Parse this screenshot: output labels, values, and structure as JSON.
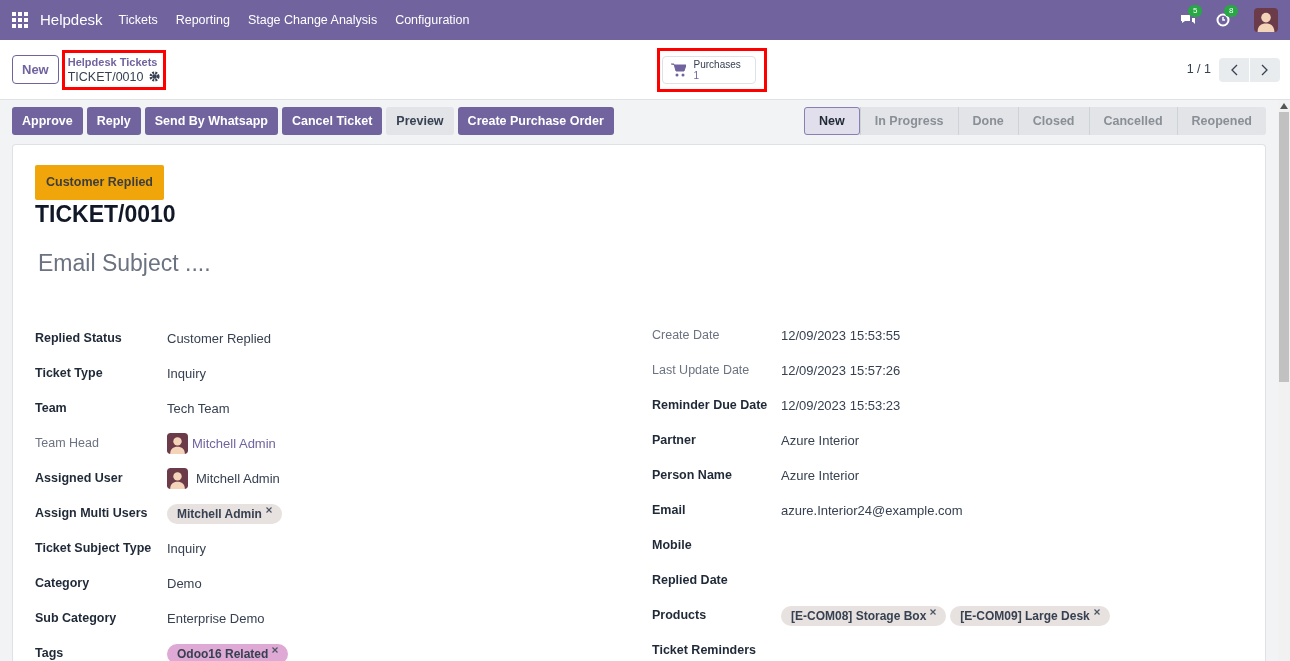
{
  "navbar": {
    "app": "Helpdesk",
    "menus": [
      "Tickets",
      "Reporting",
      "Stage Change Analysis",
      "Configuration"
    ],
    "messages_badge": "5",
    "activities_badge": "8"
  },
  "control_panel": {
    "new_button": "New",
    "breadcrumb": "Helpdesk Tickets",
    "record": "TICKET/0010",
    "smart_button": {
      "label": "Purchases",
      "count": "1"
    },
    "pager": "1 / 1"
  },
  "actions": [
    {
      "label": "Approve",
      "kind": "primary"
    },
    {
      "label": "Reply",
      "kind": "primary"
    },
    {
      "label": "Send By Whatsapp",
      "kind": "primary"
    },
    {
      "label": "Cancel Ticket",
      "kind": "primary"
    },
    {
      "label": "Preview",
      "kind": "secondary"
    },
    {
      "label": "Create Purchase Order",
      "kind": "primary"
    }
  ],
  "stages": [
    {
      "label": "New",
      "selected": true
    },
    {
      "label": "In Progress",
      "selected": false
    },
    {
      "label": "Done",
      "selected": false
    },
    {
      "label": "Closed",
      "selected": false
    },
    {
      "label": "Cancelled",
      "selected": false
    },
    {
      "label": "Reopened",
      "selected": false
    }
  ],
  "sheet": {
    "ribbon": "Customer Replied",
    "title": "TICKET/0010",
    "subject_placeholder": "Email Subject ....",
    "left_fields": [
      {
        "label": "Replied Status",
        "kind": "text",
        "value": "Customer Replied",
        "readonly": false
      },
      {
        "label": "Ticket Type",
        "kind": "text",
        "value": "Inquiry",
        "readonly": false
      },
      {
        "label": "Team",
        "kind": "text",
        "value": "Tech Team",
        "readonly": false
      },
      {
        "label": "Team Head",
        "kind": "user_link",
        "value": "Mitchell Admin",
        "readonly": true
      },
      {
        "label": "Assigned User",
        "kind": "user",
        "value": "Mitchell Admin",
        "readonly": false
      },
      {
        "label": "Assign Multi Users",
        "kind": "tags",
        "tags": [
          {
            "label": "Mitchell Admin",
            "color": "#e7e1df"
          }
        ],
        "readonly": false
      },
      {
        "label": "Ticket Subject Type",
        "kind": "text",
        "value": "Inquiry",
        "readonly": false
      },
      {
        "label": "Category",
        "kind": "text",
        "value": "Demo",
        "readonly": false
      },
      {
        "label": "Sub Category",
        "kind": "text",
        "value": "Enterprise Demo",
        "readonly": false
      },
      {
        "label": "Tags",
        "kind": "tags",
        "tags": [
          {
            "label": "Odoo16 Related",
            "color": "#dfa9d5"
          }
        ],
        "readonly": false
      }
    ],
    "right_fields": [
      {
        "label": "Create Date",
        "kind": "text",
        "value": "12/09/2023 15:53:55",
        "readonly": true
      },
      {
        "label": "Last Update Date",
        "kind": "text",
        "value": "12/09/2023 15:57:26",
        "readonly": true
      },
      {
        "label": "Reminder Due Date",
        "kind": "text",
        "value": "12/09/2023 15:53:23",
        "readonly": false
      },
      {
        "label": "Partner",
        "kind": "text",
        "value": "Azure Interior",
        "readonly": false
      },
      {
        "label": "Person Name",
        "kind": "text",
        "value": "Azure Interior",
        "readonly": false
      },
      {
        "label": "Email",
        "kind": "text",
        "value": "azure.Interior24@example.com",
        "readonly": false
      },
      {
        "label": "Mobile",
        "kind": "empty",
        "readonly": false
      },
      {
        "label": "Replied Date",
        "kind": "empty",
        "readonly": false
      },
      {
        "label": "Products",
        "kind": "tags",
        "tags": [
          {
            "label": "[E-COM08] Storage Box",
            "color": "#e7e1df"
          },
          {
            "label": "[E-COM09] Large Desk",
            "color": "#e7e1df"
          }
        ],
        "readonly": false
      },
      {
        "label": "Ticket Reminders",
        "kind": "empty",
        "readonly": false
      }
    ]
  }
}
